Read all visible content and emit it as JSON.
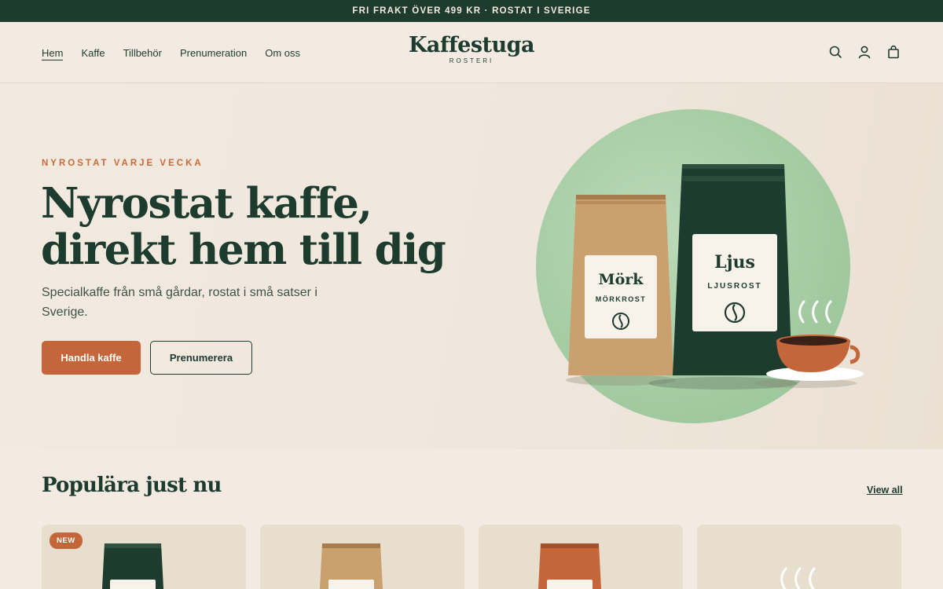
{
  "announcement": "FRI FRAKT ÖVER 499 KR · ROSTAT I SVERIGE",
  "nav": {
    "items": [
      "Hem",
      "Kaffe",
      "Tillbehör",
      "Prenumeration",
      "Om oss"
    ],
    "active": "Hem"
  },
  "logo": {
    "name": "Kaffestuga",
    "sub": "ROSTERI"
  },
  "header_icons": [
    "search-icon",
    "account-icon",
    "cart-icon"
  ],
  "hero": {
    "eyebrow": "NYROSTAT VARJE VECKA",
    "headline_line1": "Nyrostat kaffe,",
    "headline_line2": "direkt hem till dig",
    "lead": "Specialkaffe från små gårdar, rostat i små satser i Sverige.",
    "primary_cta": "Handla kaffe",
    "secondary_cta": "Prenumerera",
    "bag_dark_label": "Mörk",
    "bag_dark_sub": "MÖRKROST",
    "bag_light_label": "Ljus",
    "bag_light_sub": "LJUSROST"
  },
  "popular": {
    "title": "Populära just nu",
    "view_all": "View all",
    "cards": [
      {
        "badge": "NEW",
        "bag_color": "#1d3b2e"
      },
      {
        "badge": "",
        "bag_color": "#c9a06e"
      },
      {
        "badge": "",
        "bag_color": "#c4663a"
      },
      {
        "badge": "",
        "bag_color": ""
      }
    ]
  },
  "colors": {
    "primary_green": "#1d3b2e",
    "accent_orange": "#c4663a",
    "cream": "#f3ebe1",
    "sage": "#a9cda8",
    "kraft": "#c9a06e"
  }
}
